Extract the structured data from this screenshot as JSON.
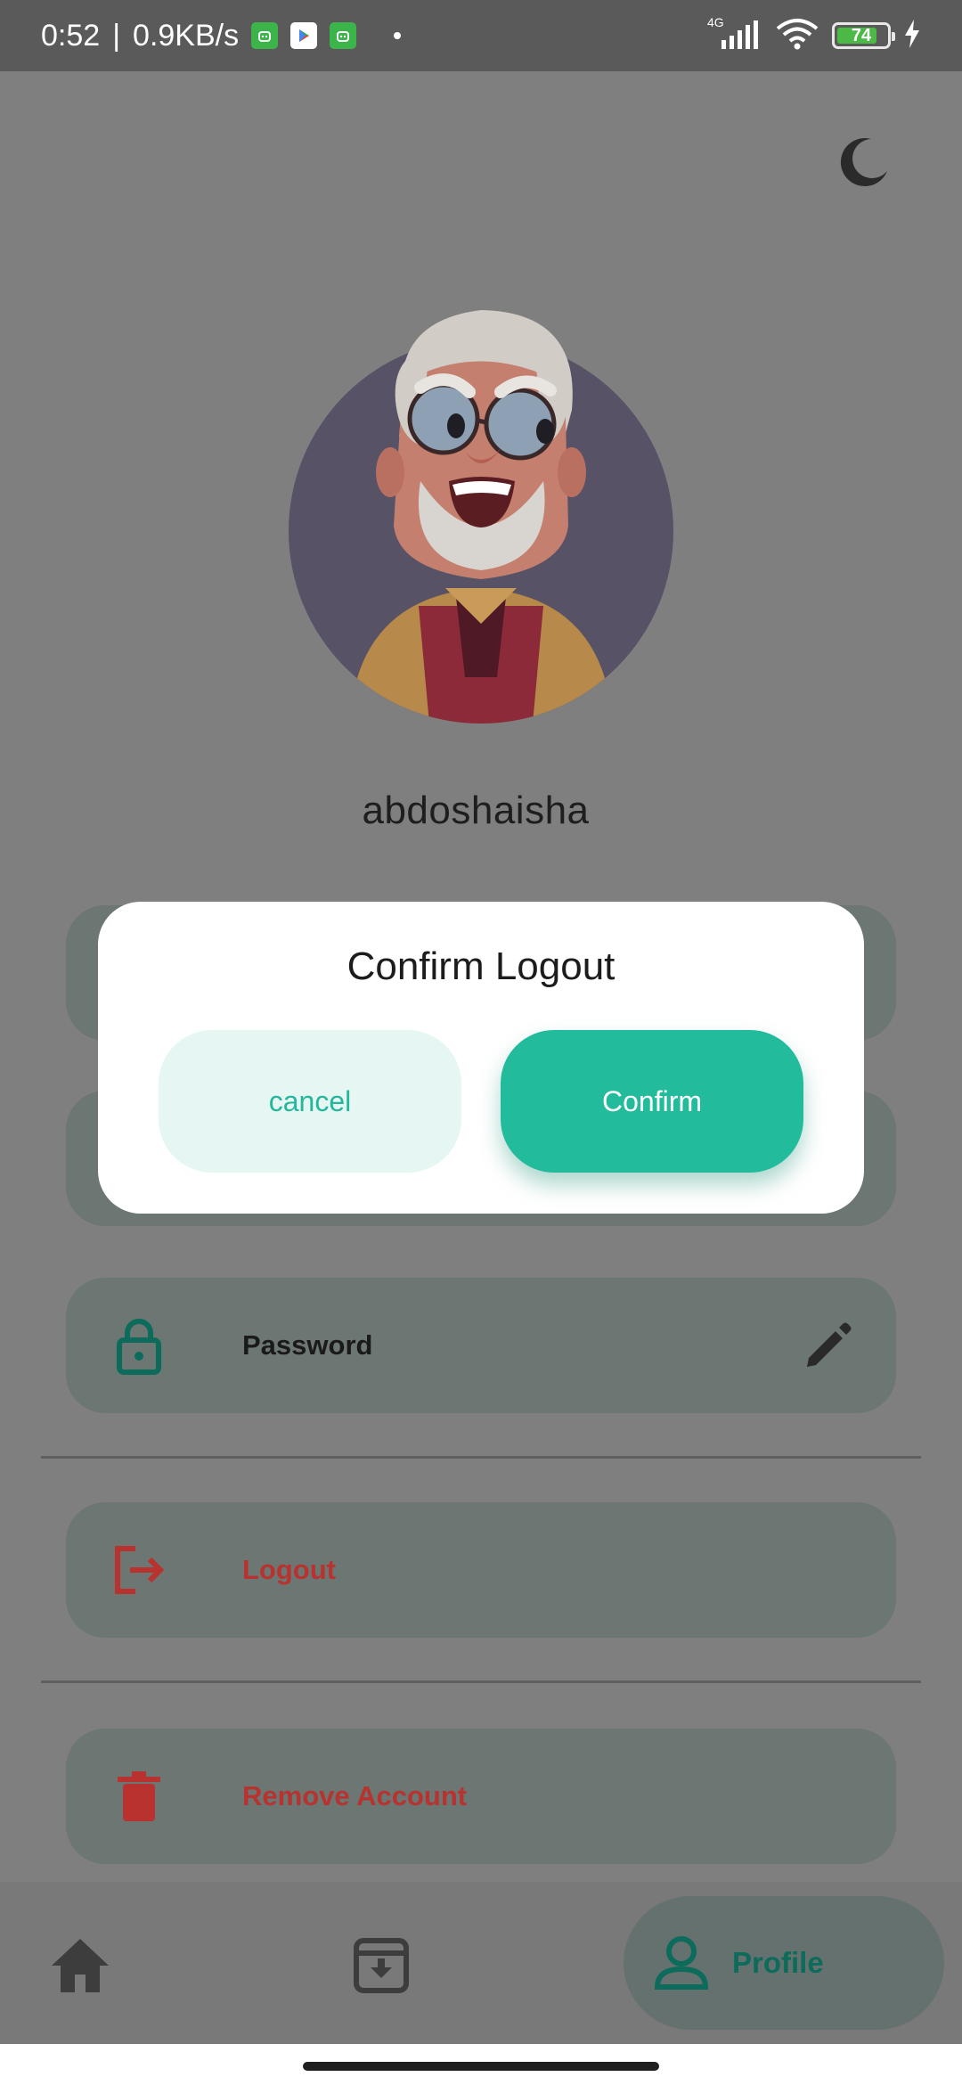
{
  "status_bar": {
    "time": "0:52",
    "separator": "|",
    "speed": "0.9KB/s",
    "network": "4G",
    "battery_level": "74"
  },
  "profile": {
    "username": "abdoshaisha"
  },
  "settings": {
    "password_label": "Password",
    "logout_label": "Logout",
    "remove_account_label": "Remove Account"
  },
  "dialog": {
    "title": "Confirm Logout",
    "cancel_label": "cancel",
    "confirm_label": "Confirm"
  },
  "bottom_nav": {
    "profile_label": "Profile"
  },
  "colors": {
    "accent": "#22bc9c",
    "danger": "#b8322f",
    "scrim": "#7f7f7f"
  },
  "icons": {
    "theme_toggle": "moon-icon",
    "password": "lock-icon",
    "edit": "pencil-icon",
    "logout": "logout-icon",
    "remove": "trash-icon",
    "home": "home-icon",
    "archive": "archive-download-icon",
    "profile": "person-icon"
  }
}
